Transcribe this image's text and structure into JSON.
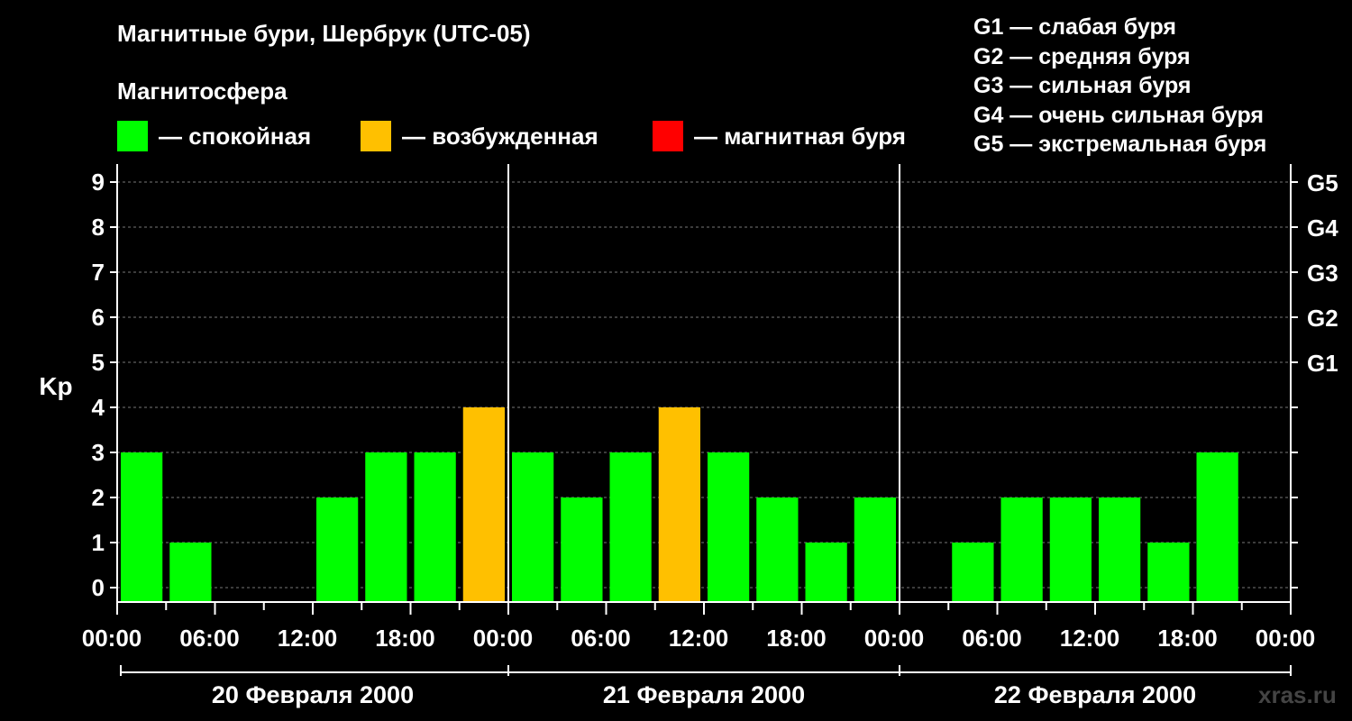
{
  "title": "Магнитные бури, Шербрук (UTC-05)",
  "subtitle": "Магнитосфера",
  "legend": [
    {
      "color": "#00ff00",
      "label": "— спокойная"
    },
    {
      "color": "#ffc000",
      "label": "— возбужденная"
    },
    {
      "color": "#ff0000",
      "label": "— магнитная буря"
    }
  ],
  "g_legend": [
    "G1 — слабая буря",
    "G2 — средняя буря",
    "G3 — сильная буря",
    "G4 — очень сильная буря",
    "G5 — экстремальная буря"
  ],
  "watermark": "xras.ru",
  "chart_data": {
    "type": "bar",
    "ylabel": "Kp",
    "ylim": [
      0,
      9
    ],
    "y_ticks": [
      0,
      1,
      2,
      3,
      4,
      5,
      6,
      7,
      8,
      9
    ],
    "g_scale": [
      {
        "label": "G1",
        "kp": 5
      },
      {
        "label": "G2",
        "kp": 6
      },
      {
        "label": "G3",
        "kp": 7
      },
      {
        "label": "G4",
        "kp": 8
      },
      {
        "label": "G5",
        "kp": 9
      }
    ],
    "x_tick_labels": [
      "00:00",
      "06:00",
      "12:00",
      "18:00",
      "00:00",
      "06:00",
      "12:00",
      "18:00",
      "00:00",
      "06:00",
      "12:00",
      "18:00",
      "00:00"
    ],
    "days": [
      "20 Февраля 2000",
      "21 Февраля 2000",
      "22 Февраля 2000"
    ],
    "interval_hours": 3,
    "colors": {
      "quiet": "#00ff00",
      "active": "#ffc000",
      "storm": "#ff0000"
    },
    "values": [
      3,
      1,
      0,
      0,
      2,
      3,
      3,
      4,
      3,
      2,
      3,
      4,
      3,
      2,
      1,
      2,
      0,
      1,
      2,
      2,
      2,
      1,
      3,
      0
    ],
    "grid": true
  }
}
